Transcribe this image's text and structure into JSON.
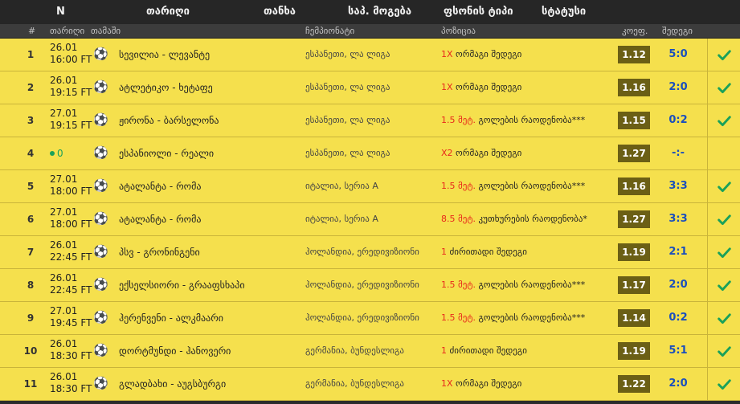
{
  "nav": {
    "n": "N",
    "date": "თარიღი",
    "amount": "თანხა",
    "total_win": "საპ. მოგება",
    "odds_type": "ფსონის ტიპი",
    "status": "სტატუსი"
  },
  "columns": {
    "num": "#",
    "date": "თარიღი",
    "match": "თამაში",
    "league": "ჩემპიონატი",
    "position": "პოზიცია",
    "odd": "კოეფ.",
    "result": "შედეგი"
  },
  "rows": [
    {
      "num": "1",
      "date": "26.01",
      "time": "16:00 FT",
      "match": "სევილია - ლევანტე",
      "league": "ესპანეთი, ლა ლიგა",
      "pred_hl": "1X",
      "pred": "ორმაგი შედეგი",
      "odd": "1.12",
      "result": "5:0",
      "won": true
    },
    {
      "num": "2",
      "date": "26.01",
      "time": "19:15 FT",
      "match": "ატლეტიკო - ხეტაფე",
      "league": "ესპანეთი, ლა ლიგა",
      "pred_hl": "1X",
      "pred": "ორმაგი შედეგი",
      "odd": "1.16",
      "result": "2:0",
      "won": true
    },
    {
      "num": "3",
      "date": "27.01",
      "time": "19:15 FT",
      "match": "ჟირონა - ბარსელონა",
      "league": "ესპანეთი, ლა ლიგა",
      "pred_hl": "1.5 მეტ.",
      "pred": "გოლების რაოდენობა***",
      "odd": "1.15",
      "result": "0:2",
      "won": true
    },
    {
      "num": "4",
      "live": "0",
      "match": "ესპანიოლი - რეალი",
      "league": "ესპანეთი, ლა ლიგა",
      "pred_hl": "X2",
      "pred": "ორმაგი შედეგი",
      "odd": "1.27",
      "result": "-:-",
      "won": false
    },
    {
      "num": "5",
      "date": "27.01",
      "time": "18:00 FT",
      "match": "ატალანტა - რომა",
      "league": "იტალია, სერია A",
      "pred_hl": "1.5 მეტ.",
      "pred": "გოლების რაოდენობა***",
      "odd": "1.16",
      "result": "3:3",
      "won": true
    },
    {
      "num": "6",
      "date": "27.01",
      "time": "18:00 FT",
      "match": "ატალანტა - რომა",
      "league": "იტალია, სერია A",
      "pred_hl": "8.5 მეტ.",
      "pred": "კუთხურების რაოდენობა*",
      "odd": "1.27",
      "result": "3:3",
      "won": true
    },
    {
      "num": "7",
      "date": "26.01",
      "time": "22:45 FT",
      "match": "პსვ - გრონინგენი",
      "league": "ჰოლანდია, ერედივიზიონი",
      "pred_hl": "1",
      "pred": "ძირითადი შედეგი",
      "odd": "1.19",
      "result": "2:1",
      "won": true
    },
    {
      "num": "8",
      "date": "26.01",
      "time": "22:45 FT",
      "match": "ექსელსიორი - გრააფსხაპი",
      "league": "ჰოლანდია, ერედივიზიონი",
      "pred_hl": "1.5 მეტ.",
      "pred": "გოლების რაოდენობა***",
      "odd": "1.17",
      "result": "2:0",
      "won": true
    },
    {
      "num": "9",
      "date": "27.01",
      "time": "19:45 FT",
      "match": "ჰერენვენი - ალკმაარი",
      "league": "ჰოლანდია, ერედივიზიონი",
      "pred_hl": "1.5 მეტ.",
      "pred": "გოლების რაოდენობა***",
      "odd": "1.14",
      "result": "0:2",
      "won": true
    },
    {
      "num": "10",
      "date": "26.01",
      "time": "18:30 FT",
      "match": "დორტმუნდი - ჰანოვერი",
      "league": "გერმანია, ბუნდესლიგა",
      "pred_hl": "1",
      "pred": "ძირითადი შედეგი",
      "odd": "1.19",
      "result": "5:1",
      "won": true
    },
    {
      "num": "11",
      "date": "26.01",
      "time": "18:30 FT",
      "match": "გლადბახი - აუგსბურგი",
      "league": "გერმანია, ბუნდესლიგა",
      "pred_hl": "1X",
      "pred": "ორმაგი შედეგი",
      "odd": "1.22",
      "result": "2:0",
      "won": true
    }
  ],
  "icons": {
    "ball": "soccer-ball-icon",
    "check": "check-icon",
    "live": "live-dot-icon"
  },
  "colors": {
    "row_bg": "#f5e04d",
    "odd_bg": "#6b5f15",
    "highlight": "#e8291c",
    "result": "#1a4fbd",
    "check": "#1aa15a"
  }
}
